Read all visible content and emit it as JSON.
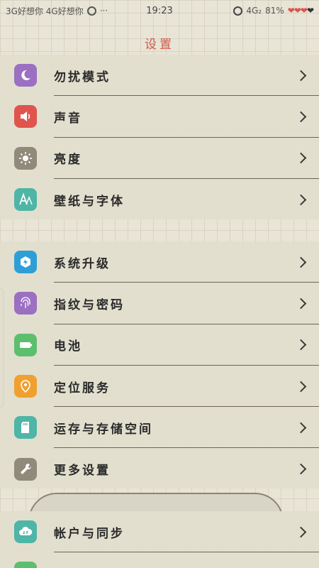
{
  "status_bar": {
    "carrier_left": "3G好想你 4G好想你",
    "more": "···",
    "time": "19:23",
    "network": "4G₂",
    "battery": "81%",
    "hearts": "❤❤❤",
    "heart_last": "❤"
  },
  "header": {
    "title": "设置"
  },
  "groups": [
    {
      "items": [
        {
          "label": "勿扰模式",
          "icon": "moon-icon",
          "color": "#9b6fc2"
        },
        {
          "label": "声音",
          "icon": "speaker-icon",
          "color": "#e0544e"
        },
        {
          "label": "亮度",
          "icon": "sun-icon",
          "color": "#8f8a7a"
        },
        {
          "label": "壁纸与字体",
          "icon": "font-icon",
          "color": "#4fb5a6"
        }
      ]
    },
    {
      "items": [
        {
          "label": "系统升级",
          "icon": "package-icon",
          "color": "#2d9fd6"
        },
        {
          "label": "指纹与密码",
          "icon": "fingerprint-icon",
          "color": "#9b6fc2"
        },
        {
          "label": "电池",
          "icon": "battery-icon",
          "color": "#5cbf6e"
        },
        {
          "label": "定位服务",
          "icon": "location-icon",
          "color": "#f0a030"
        },
        {
          "label": "运存与存储空间",
          "icon": "sdcard-icon",
          "color": "#4fb5a6"
        },
        {
          "label": "更多设置",
          "icon": "wrench-icon",
          "color": "#8f8a7a"
        }
      ]
    },
    {
      "items": [
        {
          "label": "帐户与同步",
          "icon": "cloud-sync-icon",
          "color": "#4fb5a6"
        }
      ]
    }
  ]
}
